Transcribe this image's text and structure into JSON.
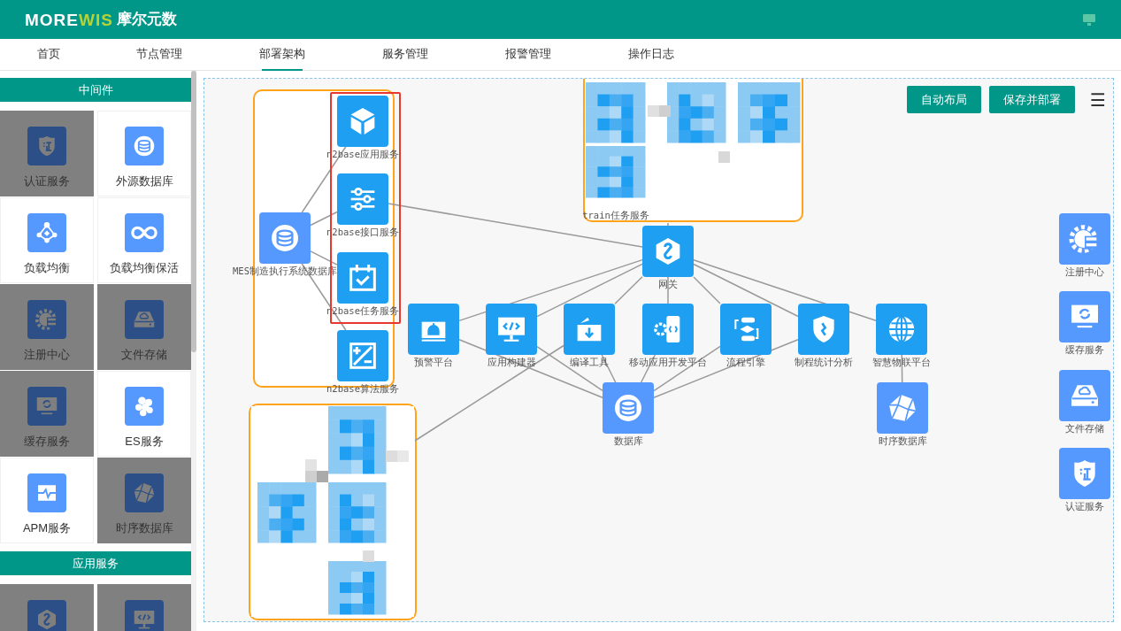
{
  "header": {
    "logo_main": "MORE",
    "logo_accent": "WIS",
    "brand": "摩尔元数"
  },
  "nav": [
    {
      "label": "首页",
      "selected": false
    },
    {
      "label": "节点管理",
      "selected": false
    },
    {
      "label": "部署架构",
      "selected": true
    },
    {
      "label": "服务管理",
      "selected": false
    },
    {
      "label": "报警管理",
      "selected": false
    },
    {
      "label": "操作日志",
      "selected": false
    }
  ],
  "sidebar": {
    "sections": [
      {
        "title": "中间件",
        "items": [
          {
            "label": "认证服务",
            "disabled": true
          },
          {
            "label": "外源数据库",
            "disabled": false
          },
          {
            "label": "负载均衡",
            "disabled": false
          },
          {
            "label": "负载均衡保活",
            "disabled": false
          },
          {
            "label": "注册中心",
            "disabled": true
          },
          {
            "label": "文件存储",
            "disabled": true
          },
          {
            "label": "缓存服务",
            "disabled": true
          },
          {
            "label": "ES服务",
            "disabled": false
          },
          {
            "label": "APM服务",
            "disabled": false
          },
          {
            "label": "时序数据库",
            "disabled": true
          }
        ]
      },
      {
        "title": "应用服务",
        "items": [
          {
            "disabled": true
          },
          {
            "disabled": true
          }
        ]
      }
    ]
  },
  "canvas": {
    "buttons": [
      "自动布局",
      "保存并部署"
    ],
    "menu_icon": "☰",
    "groups": [
      {
        "selected": false
      },
      {
        "selected": true
      },
      {
        "selected": false
      },
      {
        "selected": false
      }
    ],
    "nodes": [
      {
        "kind": "icon",
        "label": "MES制造执行系统数据库",
        "color": "#5599ff"
      },
      {
        "kind": "icon",
        "label": "n2base应用服务",
        "color": "#1e9ff2"
      },
      {
        "kind": "icon",
        "label": "n2base接口服务",
        "color": "#1e9ff2"
      },
      {
        "kind": "icon",
        "label": "n2base任务服务",
        "color": "#1e9ff2"
      },
      {
        "kind": "icon",
        "label": "n2base算法服务",
        "color": "#1e9ff2"
      },
      {
        "kind": "icon",
        "label": "网关",
        "color": "#1e9ff2"
      },
      {
        "kind": "icon",
        "label": "预警平台",
        "color": "#1e9ff2"
      },
      {
        "kind": "icon",
        "label": "应用构建器",
        "color": "#1e9ff2"
      },
      {
        "kind": "icon",
        "label": "编译工具",
        "color": "#1e9ff2"
      },
      {
        "kind": "icon",
        "label": "移动应用开发平台",
        "color": "#1e9ff2"
      },
      {
        "kind": "icon",
        "label": "流程引擎",
        "color": "#1e9ff2"
      },
      {
        "kind": "icon",
        "label": "制程统计分析",
        "color": "#1e9ff2"
      },
      {
        "kind": "icon",
        "label": "智慧物联平台",
        "color": "#1e9ff2"
      },
      {
        "kind": "icon",
        "label": "数据库",
        "color": "#5599ff"
      },
      {
        "kind": "icon",
        "label": "时序数据库",
        "color": "#5599ff"
      },
      {
        "kind": "icon",
        "label": "注册中心",
        "color": "#5599ff"
      },
      {
        "kind": "icon",
        "label": "缓存服务",
        "color": "#5599ff"
      },
      {
        "kind": "icon",
        "label": "文件存储",
        "color": "#5599ff"
      },
      {
        "kind": "icon",
        "label": "认证服务",
        "color": "#5599ff"
      },
      {
        "kind": "masked",
        "label": "train任务服务"
      }
    ]
  }
}
